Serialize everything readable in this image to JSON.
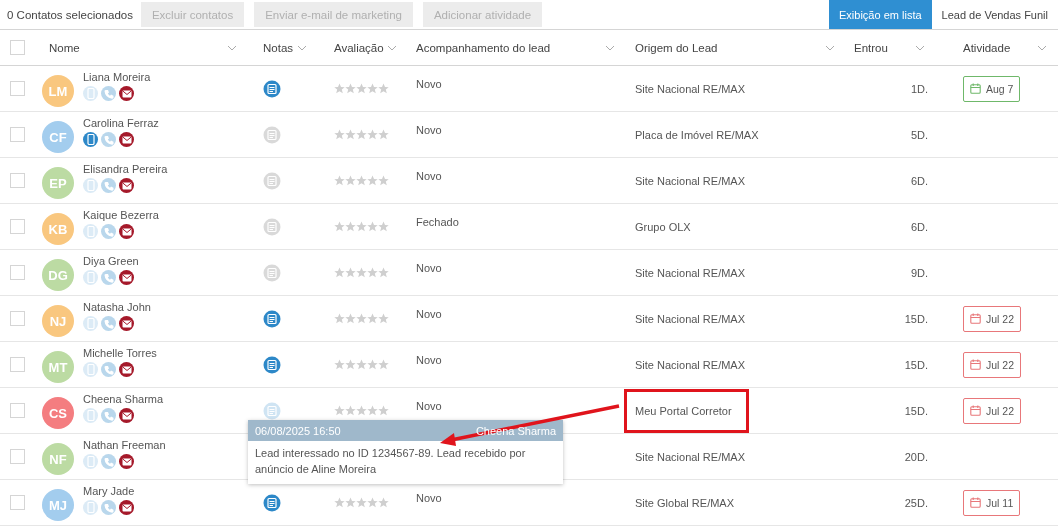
{
  "toolbar": {
    "selection_count": "0 Contatos selecionados",
    "actions": [
      {
        "label": "Excluir contatos",
        "disabled": true
      },
      {
        "label": "Enviar e-mail de marketing",
        "disabled": true
      },
      {
        "label": "Adicionar atividade",
        "disabled": true
      }
    ],
    "views": [
      {
        "label": "Exibição em lista",
        "selected": true
      },
      {
        "label": "Lead de Vendas Funil",
        "selected": false
      }
    ]
  },
  "table": {
    "select_all_checked": false,
    "columns": [
      {
        "label": "Nome"
      },
      {
        "label": "Notas"
      },
      {
        "label": "Avaliação"
      },
      {
        "label": "Acompanhamento do lead"
      },
      {
        "label": "Origem do Lead"
      },
      {
        "label": "Entrou"
      },
      {
        "label": "Atividade"
      }
    ],
    "rows": [
      {
        "initials": "LM",
        "color": "#f9c77f",
        "name": "Liana Moreira",
        "checked": false,
        "mobile_active": false,
        "notes_filled": true,
        "stars": 0,
        "status": "Novo",
        "origin": "Site Nacional RE/MAX",
        "highlighted": false,
        "entered": "1D.",
        "activity": {
          "label": "Aug 7",
          "color": "#6fb86a"
        }
      },
      {
        "initials": "CF",
        "color": "#a3cdee",
        "name": "Carolina Ferraz",
        "checked": false,
        "mobile_active": true,
        "notes_filled": false,
        "stars": 0,
        "status": "Novo",
        "origin": "Placa de Imóvel RE/MAX",
        "highlighted": false,
        "entered": "5D."
      },
      {
        "initials": "EP",
        "color": "#bcdba3",
        "name": "Elisandra Pereira",
        "checked": false,
        "mobile_active": false,
        "notes_filled": false,
        "stars": 0,
        "status": "Novo",
        "origin": "Site Nacional RE/MAX",
        "highlighted": false,
        "entered": "6D."
      },
      {
        "initials": "KB",
        "color": "#f9c77f",
        "name": "Kaique Bezerra",
        "checked": false,
        "mobile_active": false,
        "notes_filled": false,
        "stars": 0,
        "status": "Fechado",
        "origin": "Grupo OLX",
        "highlighted": false,
        "entered": "6D."
      },
      {
        "initials": "DG",
        "color": "#bcdba3",
        "name": "Diya Green",
        "checked": false,
        "mobile_active": false,
        "notes_filled": false,
        "stars": 0,
        "status": "Novo",
        "origin": "Site Nacional RE/MAX",
        "highlighted": false,
        "entered": "9D."
      },
      {
        "initials": "NJ",
        "color": "#f9c77f",
        "name": "Natasha John",
        "checked": false,
        "mobile_active": false,
        "notes_filled": true,
        "stars": 0,
        "status": "Novo",
        "origin": "Site Nacional RE/MAX",
        "highlighted": false,
        "entered": "15D.",
        "activity": {
          "label": "Jul 22",
          "color": "#e8777a"
        }
      },
      {
        "initials": "MT",
        "color": "#bcdba3",
        "name": "Michelle Torres",
        "checked": false,
        "mobile_active": false,
        "notes_filled": true,
        "stars": 0,
        "status": "Novo",
        "origin": "Site Nacional RE/MAX",
        "highlighted": false,
        "entered": "15D.",
        "activity": {
          "label": "Jul 22",
          "color": "#e8777a"
        }
      },
      {
        "initials": "CS",
        "color": "#f47d80",
        "name": "Cheena Sharma",
        "checked": false,
        "mobile_active": false,
        "notes_filled": true,
        "notes_hovered": true,
        "stars": 0,
        "status": "Novo",
        "origin": "Meu Portal Corretor",
        "highlighted": true,
        "entered": "15D.",
        "activity": {
          "label": "Jul 22",
          "color": "#e8777a"
        }
      },
      {
        "initials": "NF",
        "color": "#bcdba3",
        "name": "Nathan Freeman",
        "checked": false,
        "mobile_active": false,
        "origin": "Site Nacional RE/MAX",
        "highlighted": false,
        "entered": "20D."
      },
      {
        "initials": "MJ",
        "color": "#a3cdee",
        "name": "Mary Jade",
        "checked": false,
        "mobile_active": false,
        "notes_filled": true,
        "stars": 0,
        "status": "Novo",
        "origin": "Site Global RE/MAX",
        "highlighted": false,
        "entered": "25D.",
        "activity": {
          "label": "Jul 11",
          "color": "#e8777a"
        }
      }
    ]
  },
  "note_tooltip": {
    "date": "06/08/2025 16:50",
    "author": "Cheena Sharma",
    "text": "Lead interessado no ID 1234567-89. Lead recebido por anúncio de Aline Moreira"
  }
}
